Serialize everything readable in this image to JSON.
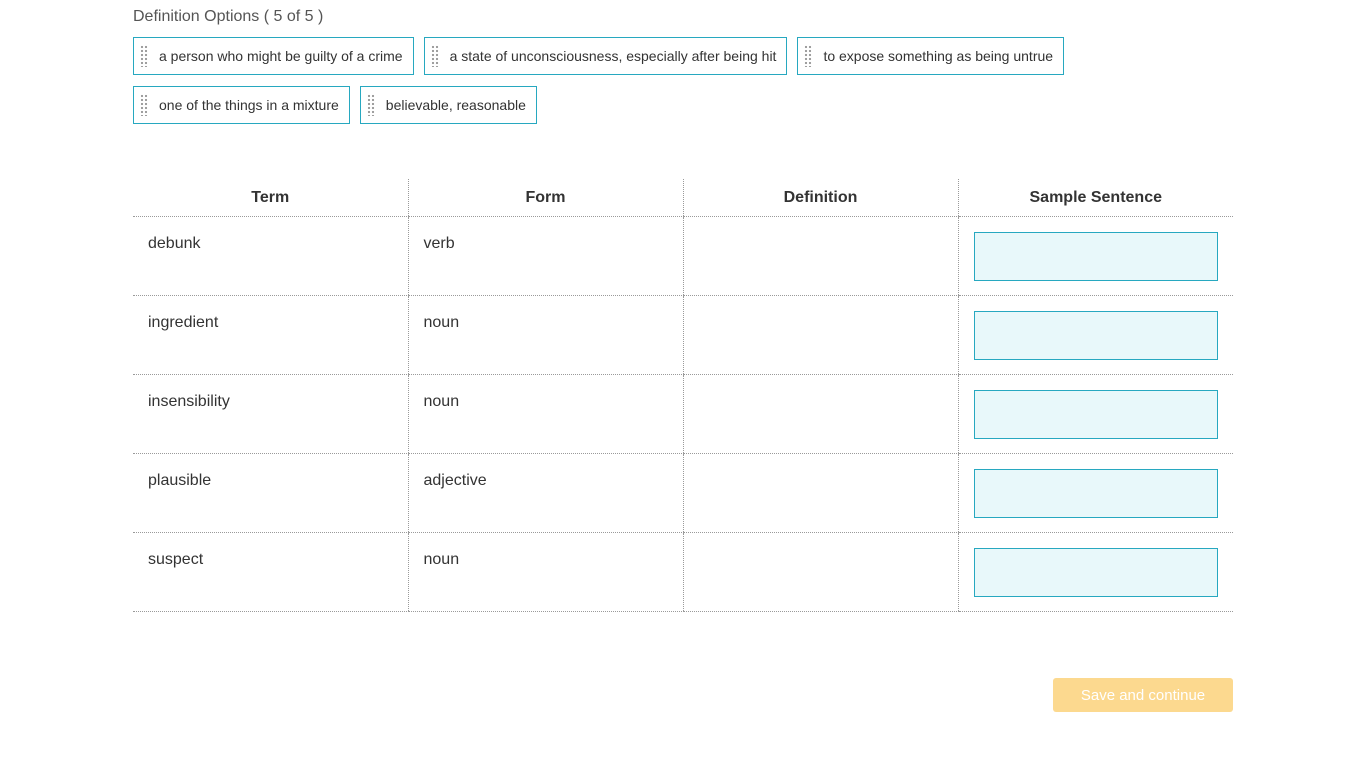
{
  "definition_options": {
    "label": "Definition Options ( 5 of 5 )",
    "chips": [
      "a person who might be guilty of a crime",
      "a state of unconsciousness, especially after being hit",
      "to expose something as being untrue",
      "one of the things in a mixture",
      "believable, reasonable"
    ]
  },
  "table": {
    "headers": [
      "Term",
      "Form",
      "Definition",
      "Sample Sentence"
    ],
    "rows": [
      {
        "term": "debunk",
        "form": "verb"
      },
      {
        "term": "ingredient",
        "form": "noun"
      },
      {
        "term": "insensibility",
        "form": "noun"
      },
      {
        "term": "plausible",
        "form": "adjective"
      },
      {
        "term": "suspect",
        "form": "noun"
      }
    ]
  },
  "actions": {
    "save_label": "Save and continue"
  },
  "colors": {
    "accent": "#27a8c0",
    "sample_fill": "#e8f8fa",
    "save_button_disabled": "#fcd98f"
  },
  "icons": {
    "chip_handle": "drag-handle-icon"
  }
}
